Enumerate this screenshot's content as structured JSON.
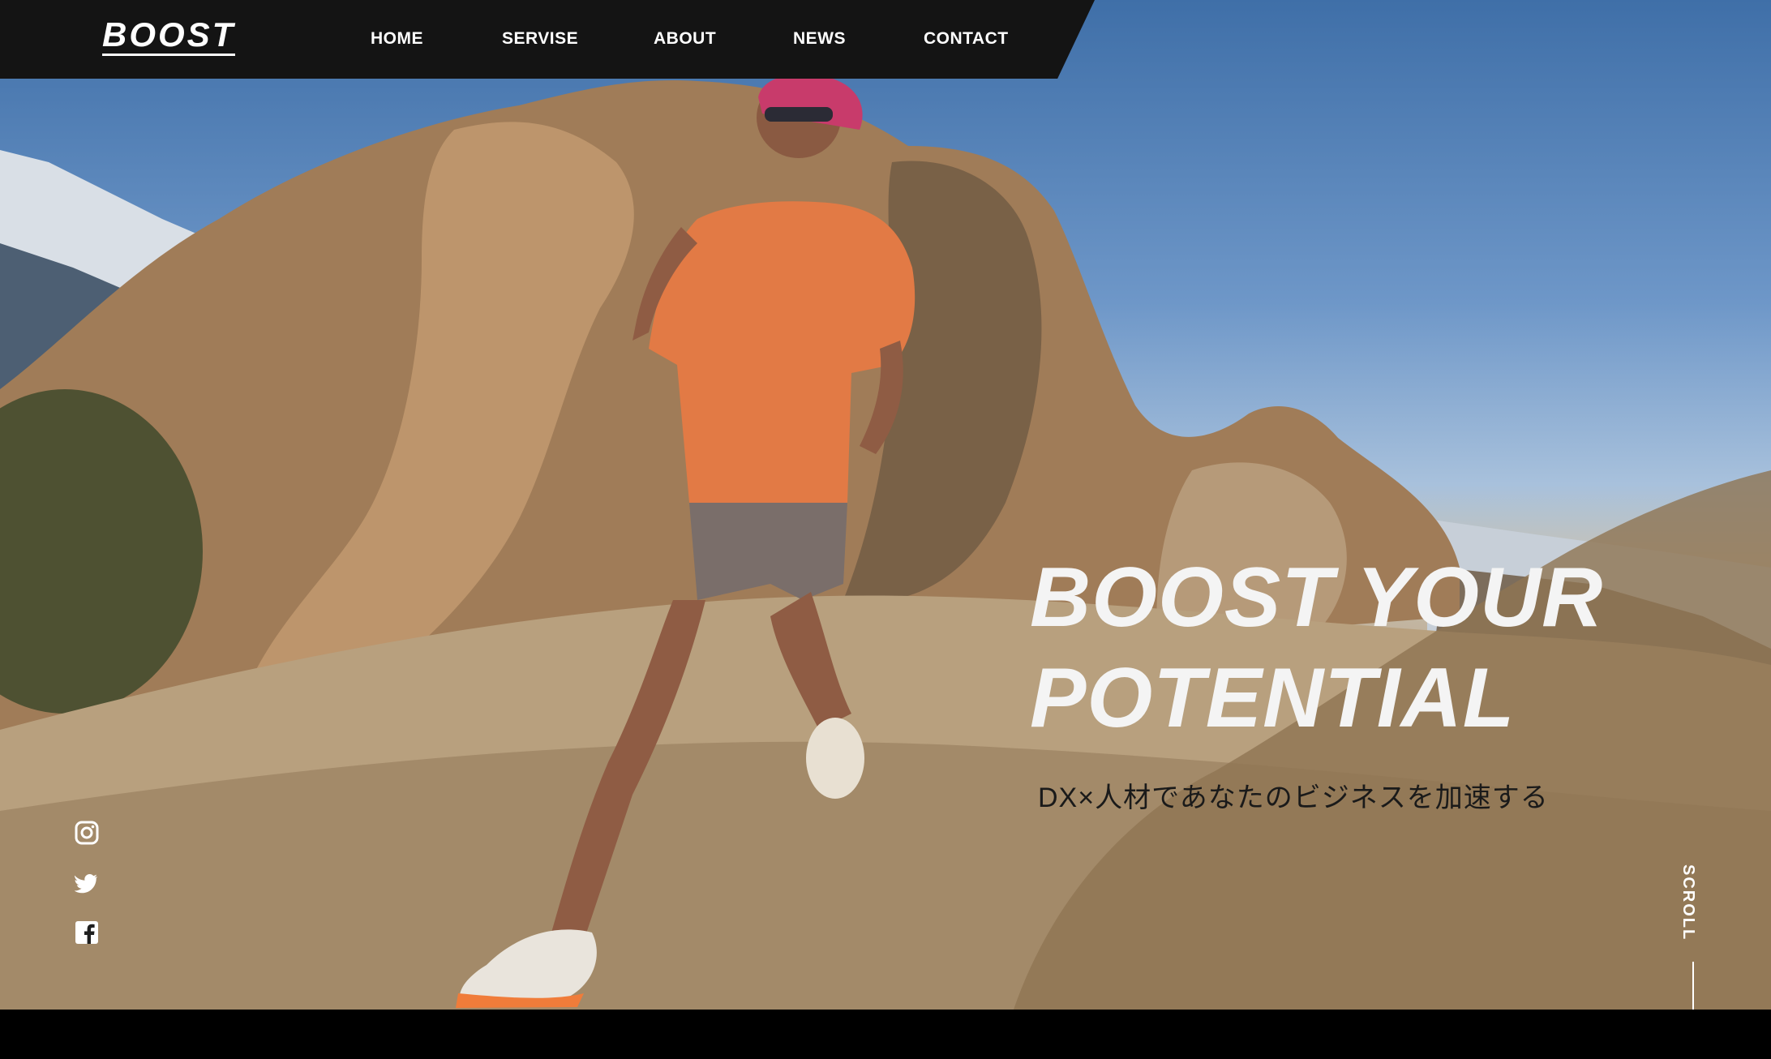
{
  "header": {
    "logo": "BOOST",
    "nav": [
      "HOME",
      "SERVISE",
      "ABOUT",
      "NEWS",
      "CONTACT"
    ]
  },
  "hero": {
    "headline_line1": "BOOST YOUR",
    "headline_line2": "POTENTIAL",
    "subline": "DX×人材であなたのビジネスを加速する",
    "image": "trail-runner-photo"
  },
  "social": [
    "instagram-icon",
    "twitter-icon",
    "facebook-icon"
  ],
  "scroll": {
    "label": "SCROLL"
  },
  "colors": {
    "header_bg": "#141414",
    "text_light": "#ffffff",
    "text_dark": "#1a1a1a"
  }
}
